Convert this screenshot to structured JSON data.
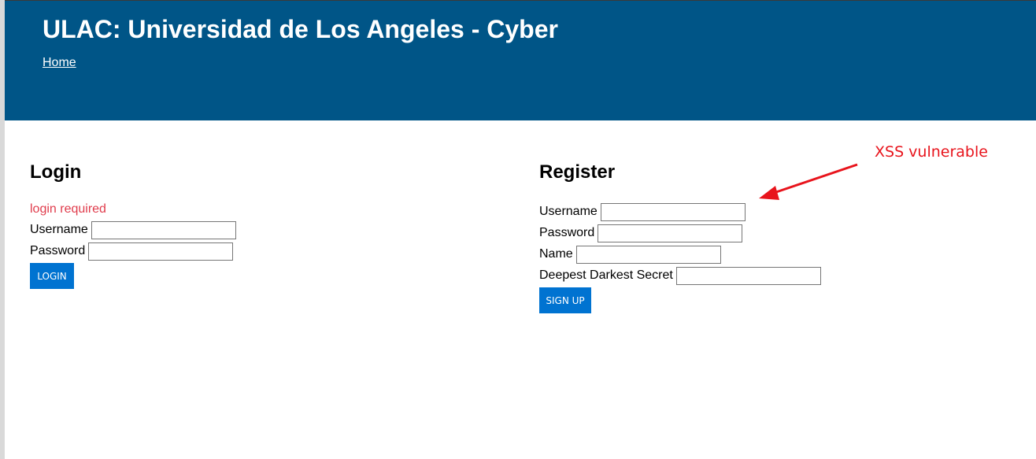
{
  "header": {
    "title": "ULAC: Universidad de Los Angeles - Cyber",
    "nav": {
      "home_label": "Home"
    }
  },
  "login": {
    "title": "Login",
    "error": "login required",
    "username_label": "Username",
    "username_value": "",
    "password_label": "Password",
    "password_value": "",
    "submit_label": "LOGIN"
  },
  "register": {
    "title": "Register",
    "username_label": "Username",
    "username_value": "",
    "password_label": "Password",
    "password_value": "",
    "name_label": "Name",
    "name_value": "",
    "secret_label": "Deepest Darkest Secret",
    "secret_value": "",
    "submit_label": "SIGN UP"
  },
  "annotation": {
    "text": "XSS vulnerable",
    "color": "#e8141c"
  },
  "colors": {
    "header_bg": "#005587",
    "button_bg": "#0073d1",
    "error_text": "#e03c4c"
  }
}
